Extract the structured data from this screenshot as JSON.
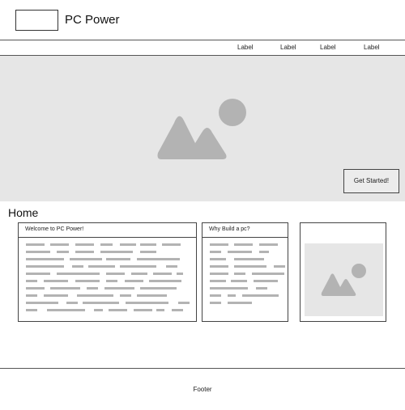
{
  "header": {
    "title": "PC Power",
    "logo_icon": "logo-placeholder-icon"
  },
  "nav": {
    "items": [
      {
        "label": "Label"
      },
      {
        "label": "Label"
      },
      {
        "label": "Label"
      },
      {
        "label": "Label"
      }
    ]
  },
  "hero": {
    "image_icon": "image-placeholder-icon",
    "cta_label": "Get Started!",
    "background_color": "#e6e6e6"
  },
  "home": {
    "heading": "Home",
    "welcome_card": {
      "title": "Welcome to PC Power!"
    },
    "why_card": {
      "title": "Why Build a pc?"
    },
    "image_card": {
      "image_icon": "image-placeholder-icon"
    }
  },
  "footer": {
    "label": "Footer"
  }
}
